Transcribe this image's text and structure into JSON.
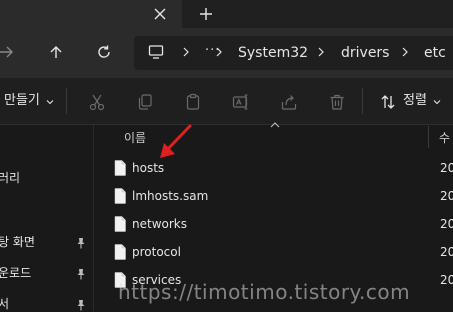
{
  "titlebar": {
    "close_tab_icon": "close-icon",
    "new_tab_icon": "plus-icon"
  },
  "navigation": {
    "forward_icon": "arrow-right-icon",
    "up_icon": "arrow-up-icon",
    "refresh_icon": "refresh-icon"
  },
  "address_bar": {
    "root_icon": "this-pc-icon",
    "overflow": "···",
    "breadcrumbs": [
      "System32",
      "drivers",
      "etc"
    ]
  },
  "toolbar": {
    "new_label": "만들기",
    "actions": [
      "cut-icon",
      "copy-icon",
      "paste-icon",
      "rename-icon",
      "share-icon",
      "delete-icon"
    ],
    "sort_label": "정렬"
  },
  "sidebar": {
    "items": [
      {
        "label": "러리",
        "pinned": false
      },
      {
        "label": "탕 화면",
        "pinned": true
      },
      {
        "label": "운로드",
        "pinned": true
      },
      {
        "label": "서",
        "pinned": true
      }
    ]
  },
  "file_list": {
    "columns": {
      "name": "이름",
      "date": "수"
    },
    "rows": [
      {
        "name": "hosts",
        "date": "20"
      },
      {
        "name": "lmhosts.sam",
        "date": "20"
      },
      {
        "name": "networks",
        "date": "20"
      },
      {
        "name": "protocol",
        "date": "20"
      },
      {
        "name": "services",
        "date": "20"
      }
    ]
  },
  "annotation": {
    "color": "#e02020",
    "points_to": "hosts"
  },
  "watermark": {
    "text": "https://timotimo.tistory.com"
  },
  "colors": {
    "background": "#191919",
    "address_row": "#2b2b2b",
    "command_bar": "#1f1f1f",
    "text": "#e6e6e6"
  }
}
